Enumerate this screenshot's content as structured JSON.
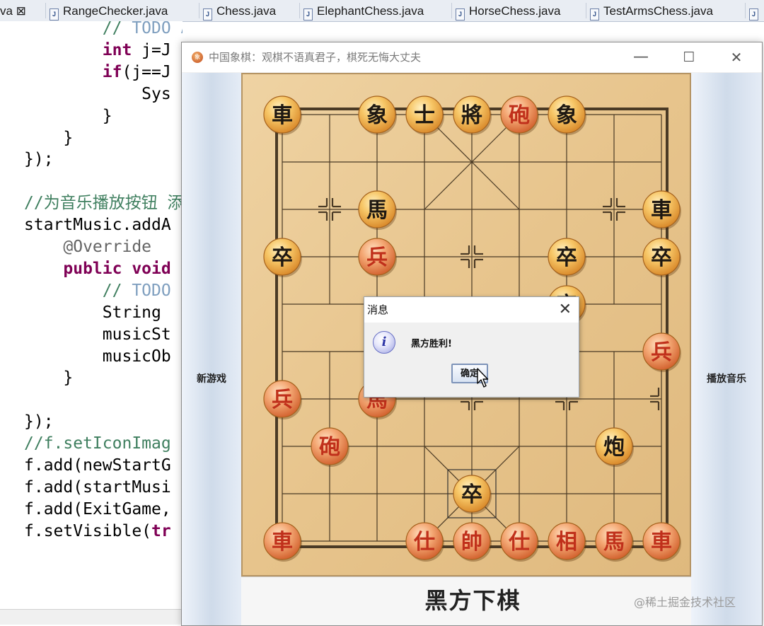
{
  "ide": {
    "tabs": [
      {
        "label": "va ⊠"
      },
      {
        "label": "RangeChecker.java"
      },
      {
        "label": "Chess.java"
      },
      {
        "label": "ElephantChess.java"
      },
      {
        "label": "HorseChess.java"
      },
      {
        "label": "TestArmsChess.java"
      },
      {
        "label": ""
      }
    ],
    "code_lines": [
      {
        "indent": "        ",
        "parts": [
          {
            "text": "// ",
            "cls": "c-comment"
          },
          {
            "text": "TODO Auto-generated method stub",
            "cls": "c-todo"
          }
        ]
      },
      {
        "indent": "        ",
        "parts": [
          {
            "text": "int",
            "cls": "c-kw"
          },
          {
            "text": " j=J",
            "cls": ""
          }
        ]
      },
      {
        "indent": "        ",
        "parts": [
          {
            "text": "if",
            "cls": "c-kw"
          },
          {
            "text": "(j==J",
            "cls": ""
          }
        ]
      },
      {
        "indent": "            ",
        "parts": [
          {
            "text": "Sys",
            "cls": ""
          }
        ]
      },
      {
        "indent": "        ",
        "parts": [
          {
            "text": "}",
            "cls": ""
          }
        ]
      },
      {
        "indent": "    ",
        "parts": [
          {
            "text": "}",
            "cls": ""
          }
        ]
      },
      {
        "indent": "",
        "parts": [
          {
            "text": "});",
            "cls": ""
          }
        ]
      },
      {
        "indent": "",
        "parts": []
      },
      {
        "indent": "",
        "parts": [
          {
            "text": "//为音乐播放按钮 添加",
            "cls": "c-comment"
          }
        ]
      },
      {
        "indent": "",
        "parts": [
          {
            "text": "startMusic.addA",
            "cls": ""
          }
        ]
      },
      {
        "indent": "    ",
        "parts": [
          {
            "text": "@Override",
            "cls": "c-ann"
          }
        ]
      },
      {
        "indent": "    ",
        "parts": [
          {
            "text": "public void",
            "cls": "c-kw"
          }
        ]
      },
      {
        "indent": "        ",
        "parts": [
          {
            "text": "// ",
            "cls": "c-comment"
          },
          {
            "text": "TODO",
            "cls": "c-todo"
          }
        ]
      },
      {
        "indent": "        ",
        "parts": [
          {
            "text": "String",
            "cls": ""
          }
        ]
      },
      {
        "indent": "        ",
        "parts": [
          {
            "text": "musicSt",
            "cls": ""
          }
        ]
      },
      {
        "indent": "        ",
        "parts": [
          {
            "text": "musicOb",
            "cls": ""
          }
        ]
      },
      {
        "indent": "    ",
        "parts": [
          {
            "text": "}",
            "cls": ""
          }
        ]
      },
      {
        "indent": "",
        "parts": []
      },
      {
        "indent": "",
        "parts": [
          {
            "text": "});",
            "cls": ""
          }
        ]
      },
      {
        "indent": "",
        "parts": [
          {
            "text": "//f.setIconImag",
            "cls": "c-comment"
          }
        ]
      },
      {
        "indent": "",
        "parts": [
          {
            "text": "f.add(newStartG",
            "cls": ""
          }
        ]
      },
      {
        "indent": "",
        "parts": [
          {
            "text": "f.add(startMusi",
            "cls": ""
          }
        ]
      },
      {
        "indent": "",
        "parts": [
          {
            "text": "f.add(ExitGame,",
            "cls": ""
          }
        ]
      },
      {
        "indent": "",
        "parts": [
          {
            "text": "f.setVisible(",
            "cls": ""
          },
          {
            "text": "tr",
            "cls": "c-kw"
          }
        ]
      }
    ]
  },
  "game": {
    "window_title": "中国象棋：观棋不语真君子，棋死无悔大丈夫",
    "app_icon_text": "象",
    "minimize": "—",
    "maximize": "☐",
    "close": "✕",
    "new_game_label": "新游戏",
    "play_music_label": "播放音乐",
    "status": "黑方下棋",
    "pieces": [
      {
        "char": "車",
        "color": "black",
        "col": 0,
        "row": 0
      },
      {
        "char": "象",
        "color": "black",
        "col": 2,
        "row": 0
      },
      {
        "char": "士",
        "color": "black",
        "col": 3,
        "row": 0
      },
      {
        "char": "將",
        "color": "black",
        "col": 4,
        "row": 0
      },
      {
        "char": "砲",
        "color": "red",
        "col": 5,
        "row": 0
      },
      {
        "char": "象",
        "color": "black",
        "col": 6,
        "row": 0
      },
      {
        "char": "馬",
        "color": "black",
        "col": 2,
        "row": 2
      },
      {
        "char": "車",
        "color": "black",
        "col": 8,
        "row": 2
      },
      {
        "char": "卒",
        "color": "black",
        "col": 0,
        "row": 3
      },
      {
        "char": "兵",
        "color": "red",
        "col": 2,
        "row": 3
      },
      {
        "char": "卒",
        "color": "black",
        "col": 6,
        "row": 3
      },
      {
        "char": "卒",
        "color": "black",
        "col": 8,
        "row": 3
      },
      {
        "char": "卒",
        "color": "black",
        "col": 6,
        "row": 4
      },
      {
        "char": "兵",
        "color": "red",
        "col": 8,
        "row": 5
      },
      {
        "char": "兵",
        "color": "red",
        "col": 0,
        "row": 6
      },
      {
        "char": "馬",
        "color": "red",
        "col": 2,
        "row": 6
      },
      {
        "char": "砲",
        "color": "red",
        "col": 1,
        "row": 7
      },
      {
        "char": "炮",
        "color": "black",
        "col": 7,
        "row": 7
      },
      {
        "char": "卒",
        "color": "black",
        "col": 4,
        "row": 8
      },
      {
        "char": "車",
        "color": "red",
        "col": 0,
        "row": 9
      },
      {
        "char": "仕",
        "color": "red",
        "col": 3,
        "row": 9
      },
      {
        "char": "帥",
        "color": "red",
        "col": 4,
        "row": 9
      },
      {
        "char": "仕",
        "color": "red",
        "col": 5,
        "row": 9
      },
      {
        "char": "相",
        "color": "red",
        "col": 6,
        "row": 9
      },
      {
        "char": "馬",
        "color": "red",
        "col": 7,
        "row": 9
      },
      {
        "char": "車",
        "color": "red",
        "col": 8,
        "row": 9
      }
    ],
    "selected": {
      "col": 4,
      "row": 8
    }
  },
  "dialog": {
    "title": "消息",
    "close": "✕",
    "info_icon": "i",
    "message": "黑方胜利!",
    "ok_label": "确定"
  },
  "watermark": "@稀土掘金技术社区",
  "colors": {
    "board_wood": "#e9c892",
    "board_line": "#4a3a25",
    "red_piece_text": "#c0301b",
    "black_piece_text": "#1e1812",
    "piece_face": "#f2b64e"
  }
}
